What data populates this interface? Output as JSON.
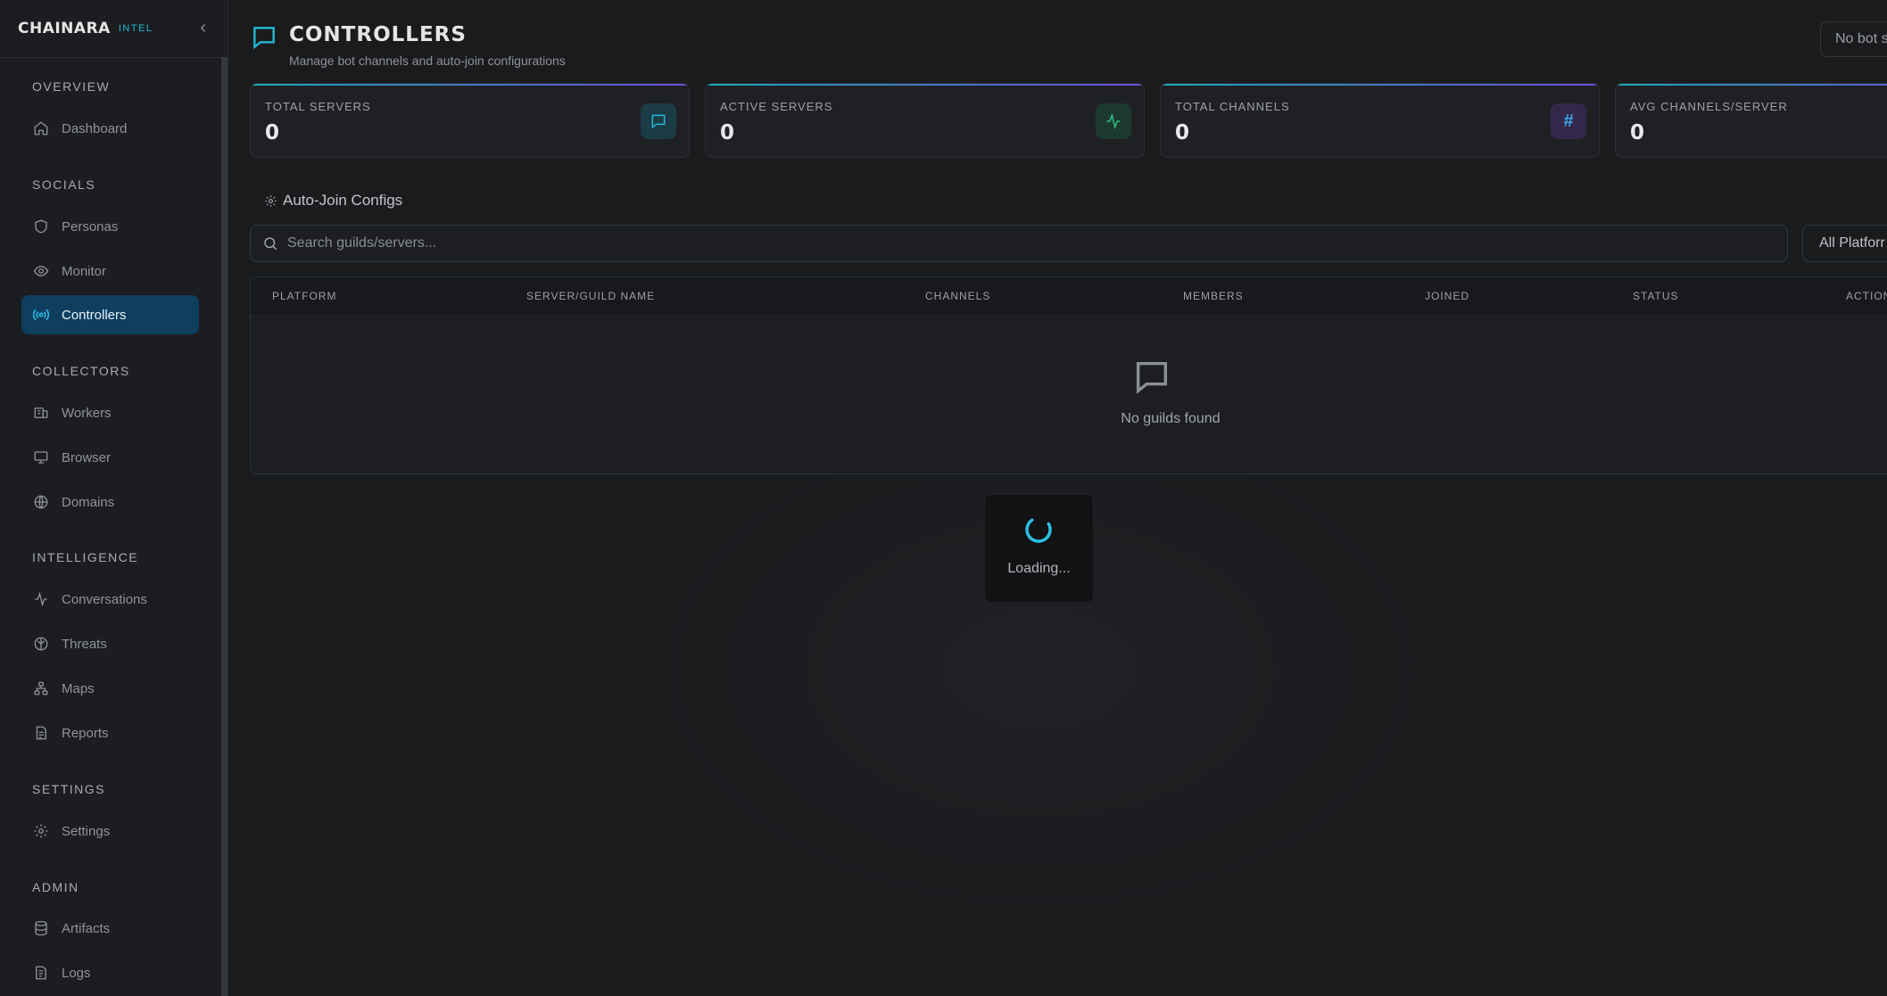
{
  "brand": {
    "name": "CHAINARA",
    "tag": "INTEL"
  },
  "sidebar": {
    "sections": [
      {
        "label": "OVERVIEW",
        "items": [
          {
            "label": "Dashboard",
            "icon": "home-icon"
          }
        ]
      },
      {
        "label": "SOCIALS",
        "items": [
          {
            "label": "Personas",
            "icon": "shield-icon"
          },
          {
            "label": "Monitor",
            "icon": "eye-icon"
          },
          {
            "label": "Controllers",
            "icon": "broadcast-icon",
            "active": true
          }
        ]
      },
      {
        "label": "COLLECTORS",
        "items": [
          {
            "label": "Workers",
            "icon": "workers-icon"
          },
          {
            "label": "Browser",
            "icon": "monitor-icon"
          },
          {
            "label": "Domains",
            "icon": "globe-icon"
          }
        ]
      },
      {
        "label": "INTELLIGENCE",
        "items": [
          {
            "label": "Conversations",
            "icon": "activity-icon"
          },
          {
            "label": "Threats",
            "icon": "brain-icon"
          },
          {
            "label": "Maps",
            "icon": "network-icon"
          },
          {
            "label": "Reports",
            "icon": "report-icon"
          }
        ]
      },
      {
        "label": "SETTINGS",
        "items": [
          {
            "label": "Settings",
            "icon": "gear-icon"
          }
        ]
      },
      {
        "label": "ADMIN",
        "items": [
          {
            "label": "Artifacts",
            "icon": "database-icon"
          },
          {
            "label": "Logs",
            "icon": "logs-icon"
          }
        ]
      }
    ]
  },
  "header": {
    "title": "CONTROLLERS",
    "subtitle": "Manage bot channels and auto-join configurations",
    "bot_select": "No bot s"
  },
  "stats": [
    {
      "label": "TOTAL SERVERS",
      "value": "0",
      "icon": "chat-icon",
      "color": "#22b8d6"
    },
    {
      "label": "ACTIVE SERVERS",
      "value": "0",
      "icon": "activity-icon",
      "color": "#2fbf86"
    },
    {
      "label": "TOTAL CHANNELS",
      "value": "0",
      "icon": "hash-icon",
      "color": "#3aa6e8"
    },
    {
      "label": "AVG CHANNELS/SERVER",
      "value": "0",
      "icon": "",
      "color": "#22b8d6"
    }
  ],
  "section": {
    "title": "Auto-Join Configs"
  },
  "search": {
    "placeholder": "Search guilds/servers..."
  },
  "platform_filter": {
    "value": "All Platforr"
  },
  "table": {
    "columns": [
      "PLATFORM",
      "SERVER/GUILD NAME",
      "CHANNELS",
      "MEMBERS",
      "JOINED",
      "STATUS",
      "ACTION"
    ],
    "empty_text": "No guilds found"
  },
  "loader": {
    "text": "Loading..."
  }
}
